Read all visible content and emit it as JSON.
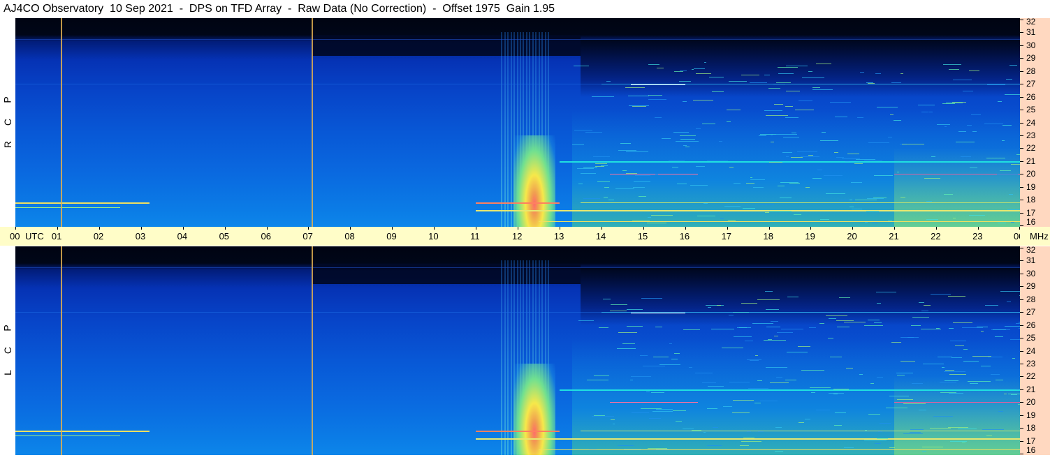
{
  "title": "AJ4CO Observatory  10 Sep 2021  -  DPS on TFD Array  -  Raw Data (No Correction)  -  Offset 1975  Gain 1.95",
  "rcp_label": [
    "R",
    "C",
    "P"
  ],
  "lcp_label": [
    "L",
    "C",
    "P"
  ],
  "utc_unit": "UTC",
  "mhz_unit": "MHz",
  "chart_data": {
    "type": "heatmap",
    "x_axis": {
      "unit": "UTC",
      "range": [
        0,
        24
      ],
      "tick_labels": [
        "00",
        "01",
        "02",
        "03",
        "04",
        "05",
        "06",
        "07",
        "08",
        "09",
        "10",
        "11",
        "12",
        "13",
        "14",
        "15",
        "16",
        "17",
        "18",
        "19",
        "20",
        "21",
        "22",
        "23",
        "00"
      ]
    },
    "y_axis": {
      "unit": "MHz",
      "range": [
        16,
        32
      ],
      "tick_labels": [
        "16",
        "17",
        "18",
        "19",
        "20",
        "21",
        "22",
        "23",
        "24",
        "25",
        "26",
        "27",
        "28",
        "29",
        "30",
        "31",
        "32"
      ]
    },
    "panels": [
      "RCP",
      "LCP"
    ],
    "colors": {
      "background": "#0a5ad8",
      "noise_floor": "#000618",
      "marker": "#e0b050",
      "burst_core": "#ff6a6a",
      "burst_outer": "#f6e84a",
      "interference": "#20e0e0"
    },
    "vertical_markers_utc": [
      1.08,
      7.08
    ],
    "burst": {
      "start_utc": 11.9,
      "end_utc": 12.9,
      "peak_freq_mhz": 17.5,
      "top_freq_mhz": 31
    }
  }
}
